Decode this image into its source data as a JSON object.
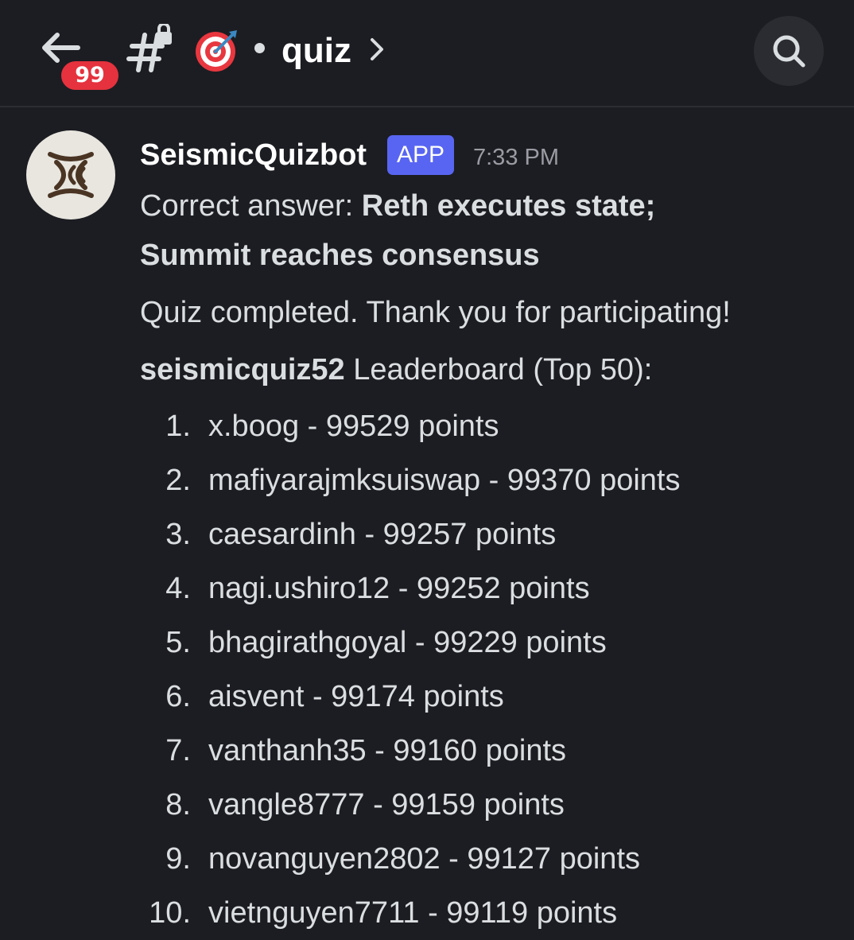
{
  "header": {
    "back_label": "Back",
    "unread_badge": "99",
    "channel_name": "quiz",
    "channel_emoji": "🎯"
  },
  "message": {
    "author": "SeismicQuizbot",
    "author_tag": "APP",
    "timestamp": "7:33 PM",
    "answer_prefix": "Correct answer: ",
    "answer_line1": "Reth executes state;",
    "answer_line2": "Summit reaches consensus",
    "completion": "Quiz completed. Thank you for participating!",
    "leaderboard_owner": "seismicquiz52",
    "leaderboard_title": " Leaderboard (Top 50):",
    "leaderboard": [
      {
        "rank": "1.",
        "entry": "x.boog - 99529 points"
      },
      {
        "rank": "2.",
        "entry": "mafiyarajmksuiswap - 99370 points"
      },
      {
        "rank": "3.",
        "entry": "caesardinh - 99257 points"
      },
      {
        "rank": "4.",
        "entry": "nagi.ushiro12 - 99252 points"
      },
      {
        "rank": "5.",
        "entry": "bhagirathgoyal - 99229 points"
      },
      {
        "rank": "6.",
        "entry": "aisvent - 99174 points"
      },
      {
        "rank": "7.",
        "entry": "vanthanh35 - 99160 points"
      },
      {
        "rank": "8.",
        "entry": "vangle8777 - 99159 points"
      },
      {
        "rank": "9.",
        "entry": "novanguyen2802 - 99127 points"
      },
      {
        "rank": "10.",
        "entry": "vietnguyen7711 - 99119 points"
      }
    ]
  },
  "colors": {
    "background": "#1c1d22",
    "badge": "#e5323e",
    "app_tag": "#5865f2",
    "timestamp": "#9b9ca3"
  }
}
